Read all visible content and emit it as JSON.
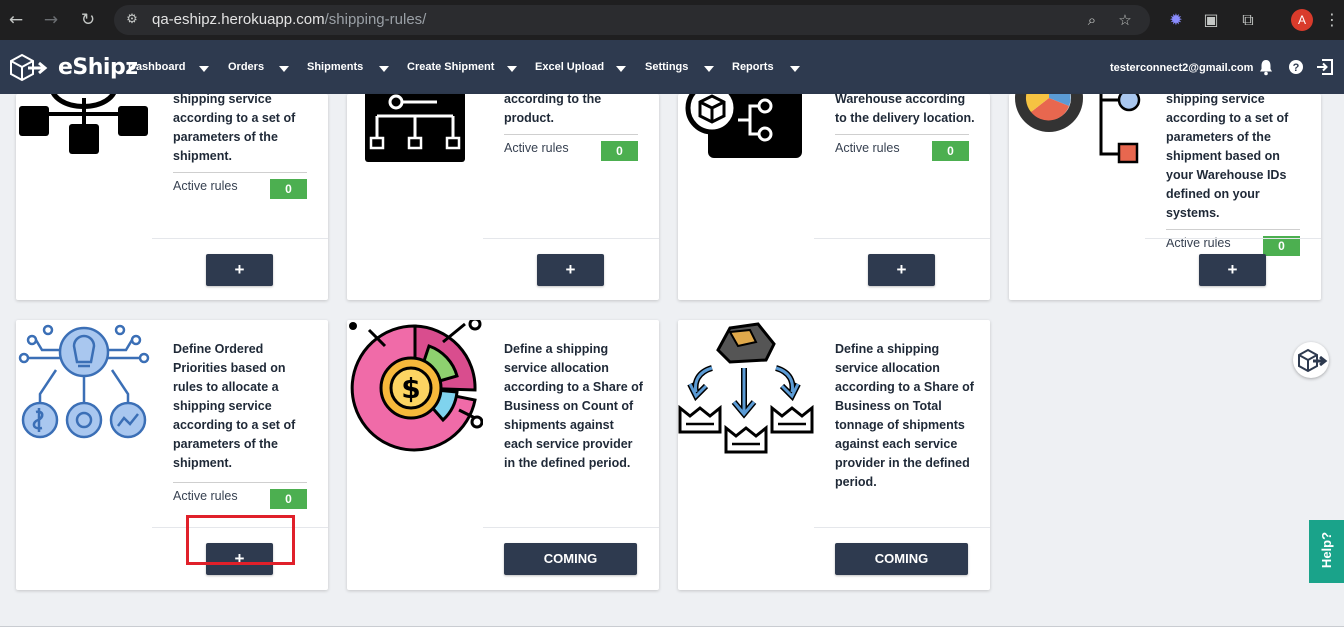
{
  "browser": {
    "url_host": "qa-eshipz.herokuapp.com",
    "url_path": "/shipping-rules/",
    "avatar_initial": "A"
  },
  "nav": {
    "brand": "eShipz",
    "items": [
      {
        "label": "Dashboard"
      },
      {
        "label": "Orders"
      },
      {
        "label": "Shipments"
      },
      {
        "label": "Create Shipment"
      },
      {
        "label": "Excel Upload"
      },
      {
        "label": "Settings"
      },
      {
        "label": "Reports"
      }
    ],
    "user_email": "testerconnect2@gmail.com"
  },
  "cards": [
    {
      "desc": "shipping service according to a set of parameters of the shipment.",
      "rules_label": "Active rules",
      "rules_count": "0",
      "action": "+"
    },
    {
      "desc": "according to the product.",
      "rules_label": "Active rules",
      "rules_count": "0",
      "action": "+"
    },
    {
      "desc": "Warehouse according to the delivery location.",
      "rules_label": "Active rules",
      "rules_count": "0",
      "action": "+"
    },
    {
      "desc": "shipping service according to a set of parameters of the shipment based on your Warehouse IDs defined on your systems.",
      "rules_label": "Active rules",
      "rules_count": "0",
      "action": "+"
    },
    {
      "desc": "Define Ordered Priorities based on rules to allocate a shipping service according to a set of parameters of the shipment.",
      "rules_label": "Active rules",
      "rules_count": "0",
      "action": "+"
    },
    {
      "desc": "Define a shipping service allocation according to a Share of Business on Count of shipments against each service provider in the defined period.",
      "action": "COMING"
    },
    {
      "desc": "Define a shipping service allocation according to a Share of Business on Total tonnage of shipments against each service provider in the defined period.",
      "action": "COMING"
    }
  ],
  "help_label": "Help?",
  "colors": {
    "navbar": "#2e3a4f",
    "rules_badge": "#4caf50",
    "highlight": "#e0202a",
    "help": "#1aa38a"
  }
}
